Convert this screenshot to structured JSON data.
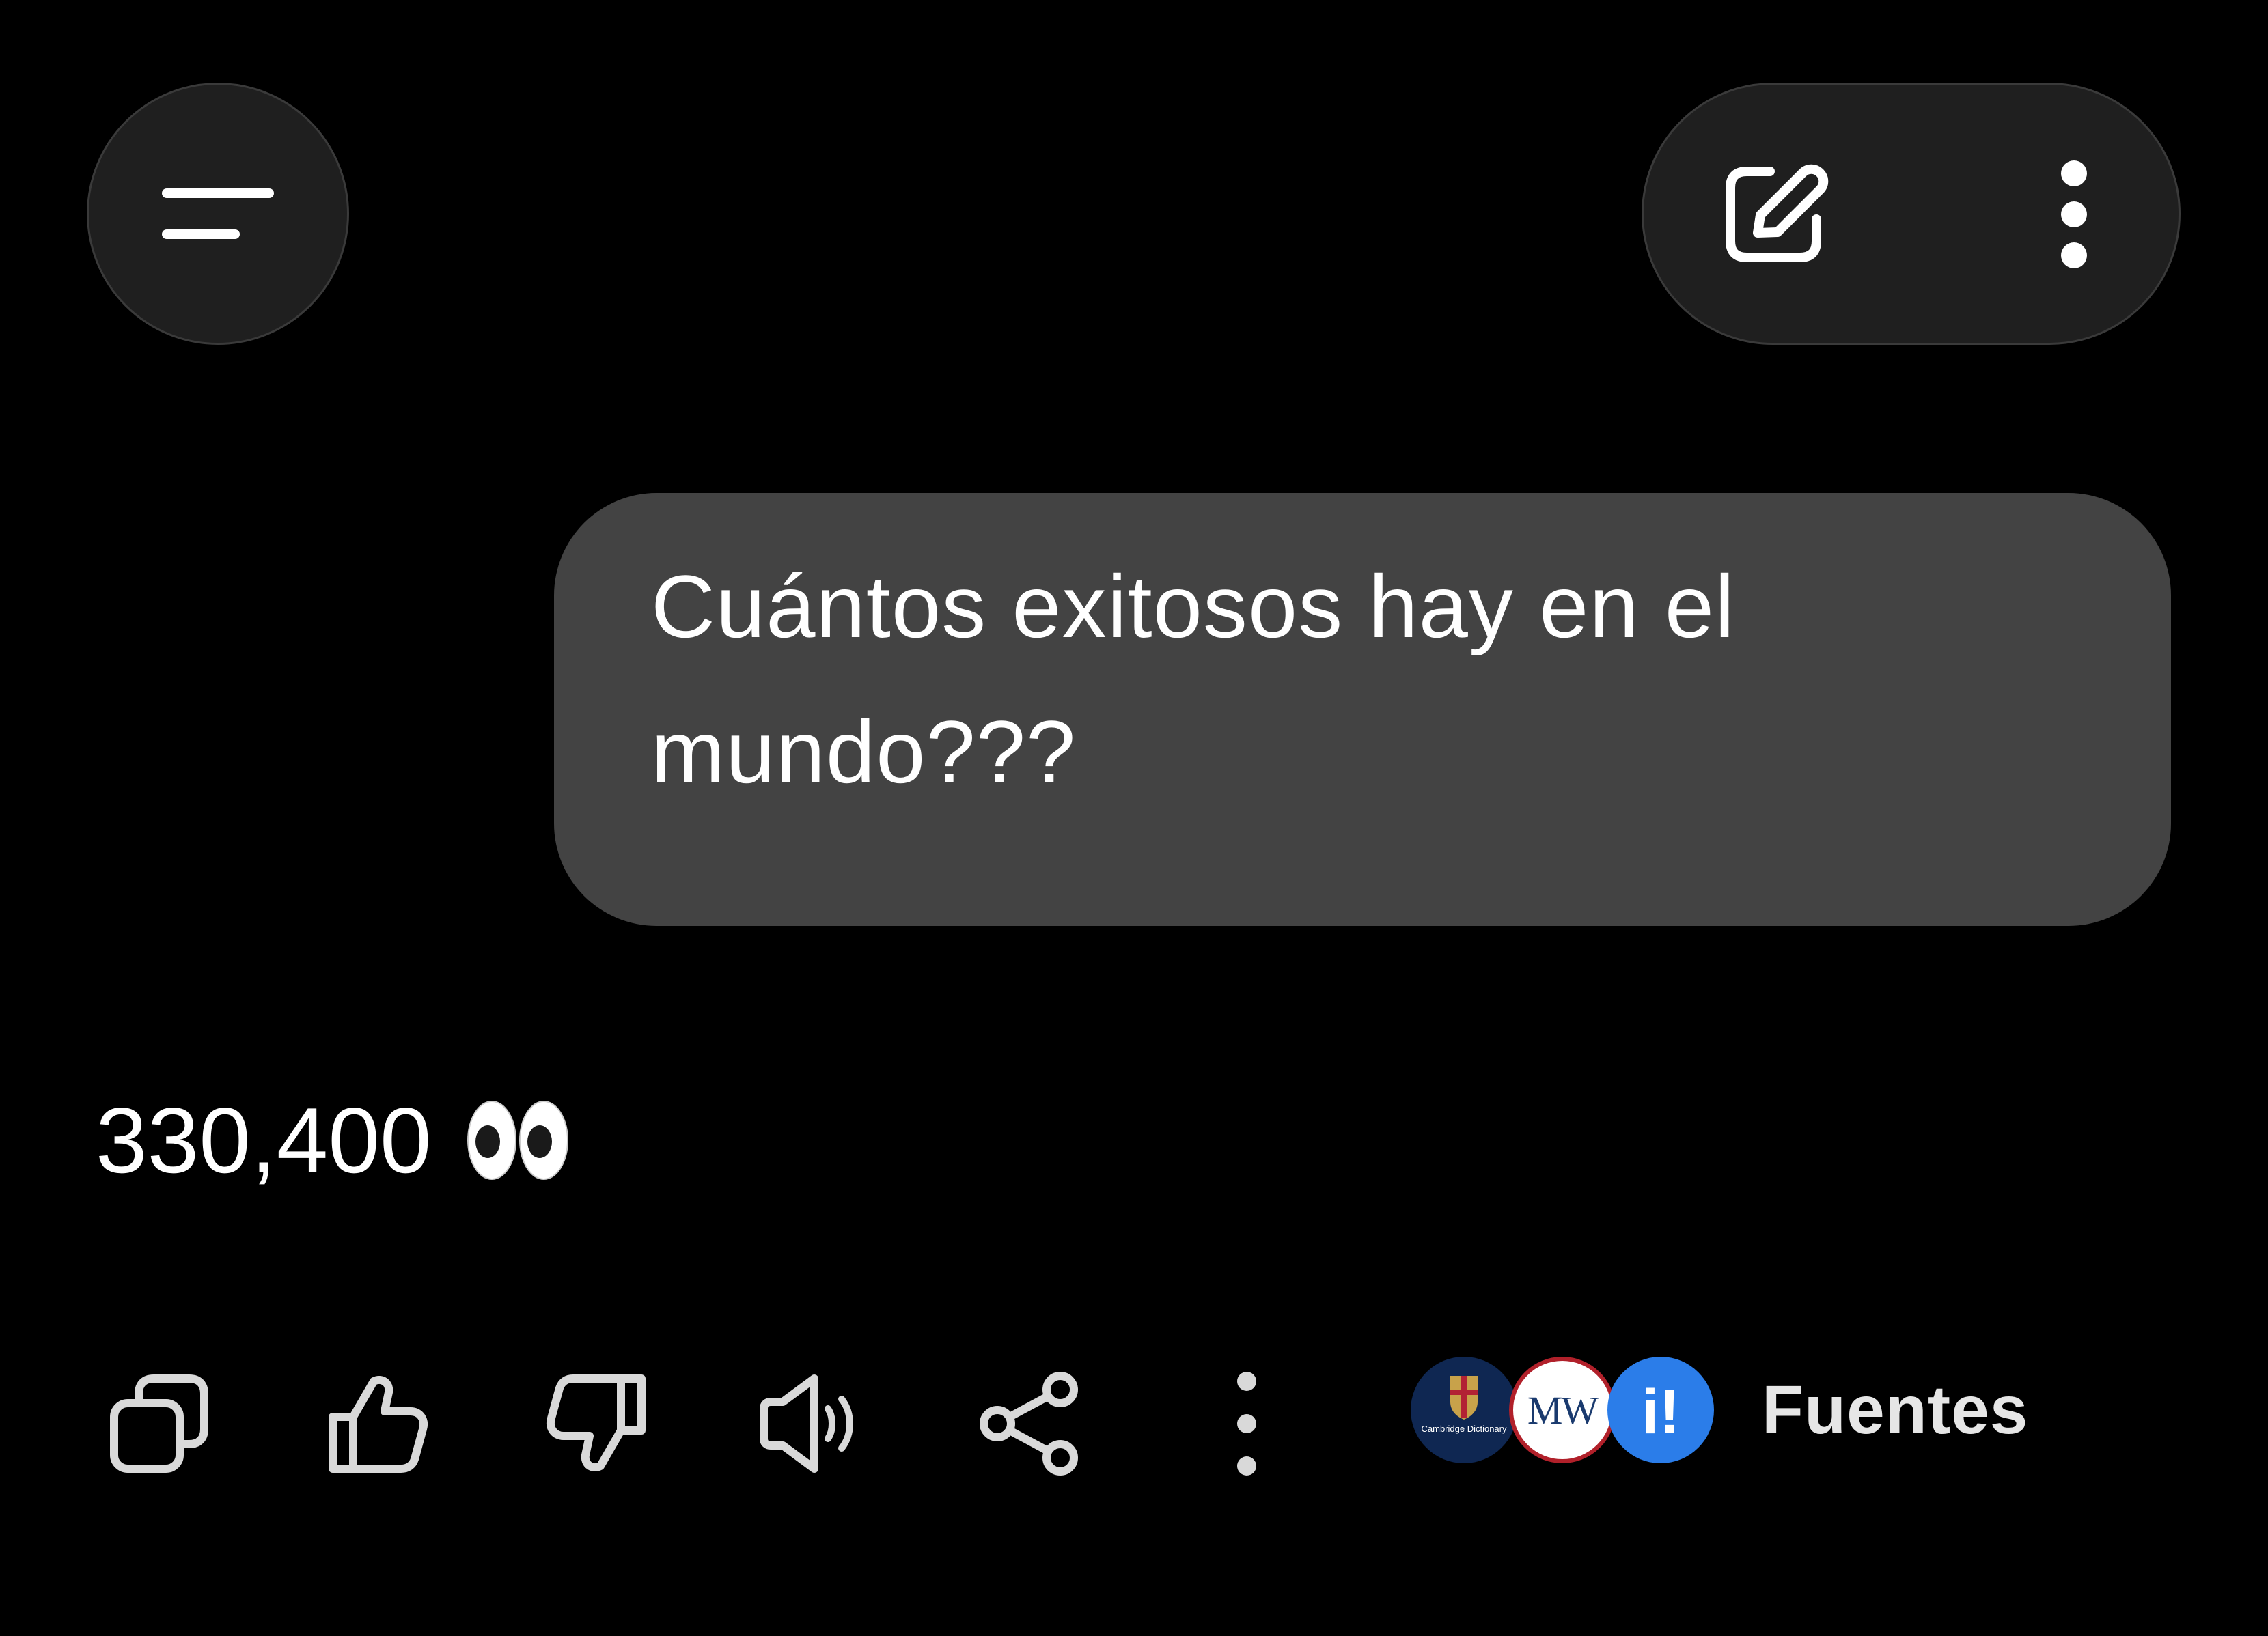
{
  "header": {
    "menu_icon": "menu-lines-icon",
    "edit_icon": "edit-pencil-icon",
    "more_icon": "more-vertical-icon"
  },
  "conversation": {
    "user_message": "Cuántos exitosos hay en el mundo???",
    "response_text": "330,400",
    "response_emoji": "eyes-emoji"
  },
  "actions": {
    "copy_icon": "copy-icon",
    "like_icon": "thumbs-up-icon",
    "dislike_icon": "thumbs-down-icon",
    "read_aloud_icon": "speaker-icon",
    "share_icon": "share-icon",
    "more_icon": "more-vertical-icon"
  },
  "sources": {
    "label": "Fuentes",
    "logos": [
      "Cambridge Dictionary",
      "MW",
      "i!"
    ]
  },
  "colors": {
    "background": "#000000",
    "bubble": "#434343",
    "control_bg": "#1f1f1f",
    "icon_light": "#d9d9d9"
  }
}
